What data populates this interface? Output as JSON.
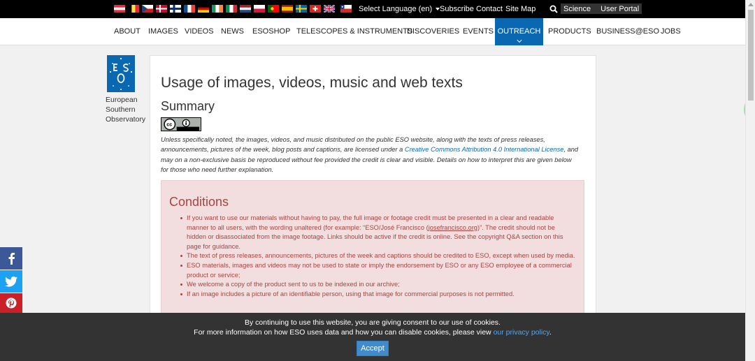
{
  "topbar": {
    "flags": [
      "austria",
      "belgium",
      "czech",
      "denmark",
      "finland",
      "france",
      "germany",
      "ireland",
      "italy",
      "netherlands",
      "poland",
      "portugal",
      "spain",
      "sweden",
      "switzerland",
      "uk",
      "chile"
    ],
    "select_language": "Select Language (en)",
    "subscribe": "Subscribe",
    "contact": "Contact",
    "site_map": "Site Map",
    "science": "Science",
    "user_portal": "User Portal"
  },
  "nav": {
    "items": [
      "ABOUT",
      "IMAGES",
      "VIDEOS",
      "NEWS",
      "ESOSHOP",
      "TELESCOPES & INSTRUMENTS",
      "DISCOVERIES",
      "EVENTS",
      "OUTREACH",
      "PRODUCTS",
      "BUSINESS@ESO",
      "JOBS"
    ],
    "active": "OUTREACH"
  },
  "logo": {
    "line1": "European",
    "line2": "Southern",
    "line3": "Observatory"
  },
  "content": {
    "title": "Usage of images, videos, music and web texts",
    "summary_heading": "Summary",
    "intro_part1": "Unless specifically noted, the images, videos, and music distributed on the public ESO website, along with the texts of press releases, announcements, pictures of the week, blog posts and captions, are licensed under a ",
    "intro_link": "Creative Commons Attribution 4.0 International License",
    "intro_part2": ", and may on a non-exclusive basis be reproduced without fee provided the credit is clear and visible. Details on how to interpret this are given below for those who need further explanation.",
    "conditions_title": "Conditions",
    "cond1_part1": "If you want to use our materials without having to pay, the full image or footage credit must be presented in a clear and readable manner to all users, with the wording unaltered (for example: “ESO/José Francisco (",
    "cond1_link": "josefrancisco.org",
    "cond1_part2": ")”. The credit should not be hidden or disassociated from the image footage. Links should be active if the credit is online. See the copyright Q&A section on this page for guidance.",
    "cond2": "The text of press releases, announcements, pictures of the week and captions should be credited to ESO, except when used by media.",
    "cond3": "ESO materials, images and videos may not be used to state or imply the endorsement by ESO or any ESO employee of a commercial product or service;",
    "cond4": "We welcome a copy of the product sent to us to be indexed in our archive;",
    "cond5": "If an image includes a picture of an identifiable person, using that image for commercial purposes is not permitted."
  },
  "cookie": {
    "line1": "By continuing to use this website, you are giving consent to our use of cookies.",
    "line2_part1": "For more information on how ESO uses data and how you can disable cookies, please view ",
    "line2_link": "our privacy policy",
    "line2_part2": ".",
    "accept": "Accept"
  },
  "floating_tab": "56",
  "colors": {
    "brand_blue": "#0a67b2",
    "alert_bg": "#f2dede",
    "alert_text": "#a94442",
    "facebook": "#3b5998",
    "twitter": "#1da1f2",
    "pinterest": "#cb2027"
  }
}
